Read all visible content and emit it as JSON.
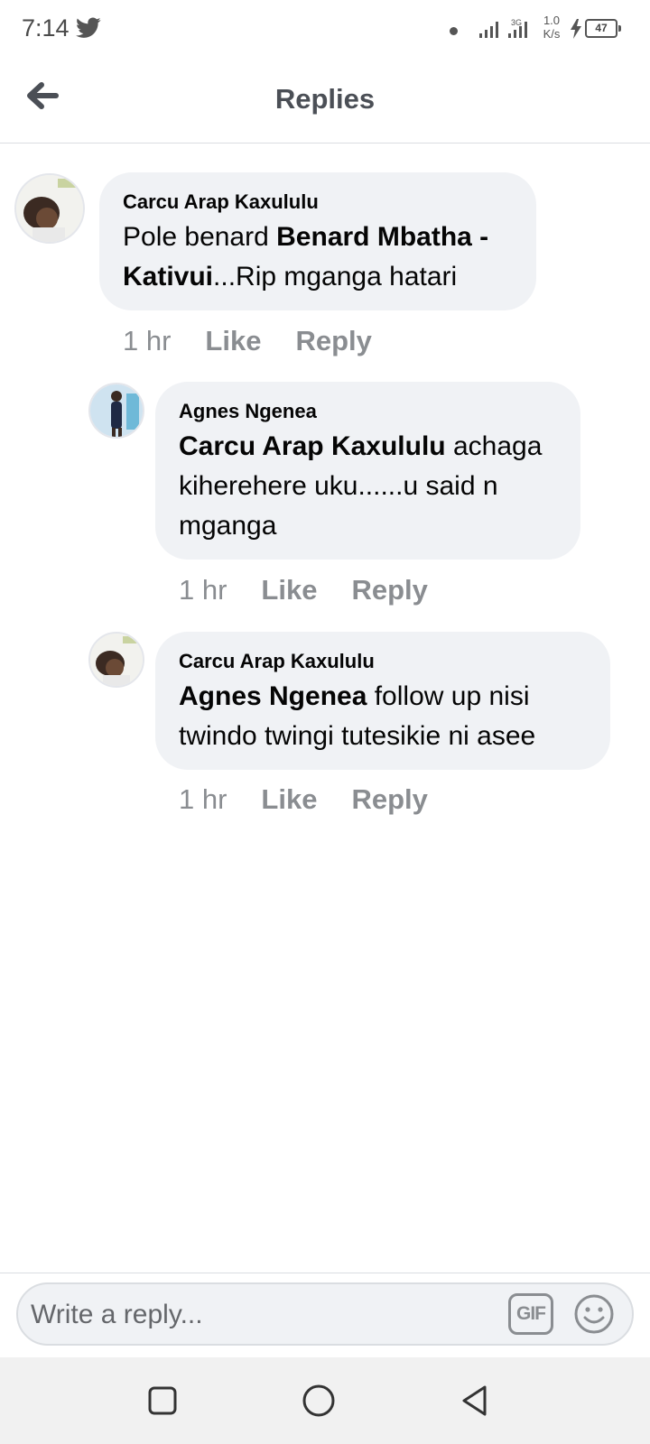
{
  "status_bar": {
    "time": "7:14",
    "network": "3G",
    "speed_value": "1.0",
    "speed_unit": "K/s",
    "battery": "47"
  },
  "header": {
    "title": "Replies",
    "back_icon": "arrow-left-icon"
  },
  "comments": [
    {
      "author": "Carcu Arap Kaxululu",
      "text_parts": [
        "Pole benard ",
        "Benard Mbatha - Kativui",
        "...Rip mganga hatari"
      ],
      "time": "1 hr",
      "like": "Like",
      "reply": "Reply"
    },
    {
      "author": "Agnes Ngenea",
      "text_parts": [
        "Carcu Arap Kaxululu",
        " achaga kiherehere uku......u said n mganga"
      ],
      "time": "1 hr",
      "like": "Like",
      "reply": "Reply"
    },
    {
      "author": "Carcu Arap Kaxululu",
      "text_parts": [
        "Agnes Ngenea",
        " follow up nisi twindo twingi tutesikie ni asee"
      ],
      "time": "1 hr",
      "like": "Like",
      "reply": "Reply"
    }
  ],
  "composer": {
    "placeholder": "Write a reply...",
    "gif_label": "GIF",
    "emoji_icon": "smiley-icon"
  },
  "navbar": {
    "icons": [
      "square-recents-icon",
      "circle-home-icon",
      "triangle-back-icon"
    ]
  },
  "colors": {
    "bubble": "#f0f2f5",
    "secondary_text": "#8a8d91",
    "header_text": "#4b4f56"
  }
}
